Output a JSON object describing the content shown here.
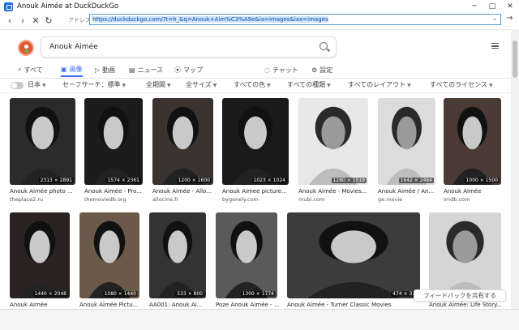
{
  "window": {
    "title": "Anouk Aimée at DuckDuckGo",
    "minimize": "─",
    "maximize": "□",
    "close": "✕"
  },
  "address_bar": {
    "label": "アドレス(D)",
    "url": "https://duckduckgo.com/?t=h_&q=Anouk+Aim%C3%A9e&ia=images&iax=images"
  },
  "nav": {
    "back": "‹",
    "forward": "›",
    "stop": "✕",
    "refresh": "↻",
    "go": "→"
  },
  "search": {
    "query": "Anouk Aimée"
  },
  "tabs": [
    {
      "label": "すべて",
      "icon": "magnifier-icon"
    },
    {
      "label": "画像",
      "icon": "image-icon",
      "active": true
    },
    {
      "label": "動画",
      "icon": "play-icon"
    },
    {
      "label": "ニュース",
      "icon": "newspaper-icon"
    },
    {
      "label": "マップ",
      "icon": "map-pin-icon"
    },
    {
      "label": "チャット",
      "icon": "chat-icon"
    },
    {
      "label": "設定",
      "icon": "gear-icon"
    }
  ],
  "filters": [
    {
      "label": "日本"
    },
    {
      "label": "セーフサーチ：標準"
    },
    {
      "label": "全期間"
    },
    {
      "label": "全サイズ"
    },
    {
      "label": "すべての色"
    },
    {
      "label": "すべての種類"
    },
    {
      "label": "すべてのレイアウト"
    },
    {
      "label": "すべてのライセンス"
    }
  ],
  "results_row1": [
    {
      "title": "Anouk Aimée photo ...",
      "source": "theplace2.ru",
      "dims": "2313 × 2891"
    },
    {
      "title": "Anouk Aimée - Pro...",
      "source": "themoviedb.org",
      "dims": "1574 × 2361"
    },
    {
      "title": "Anouk Aimée - Allo...",
      "source": "allocine.fr",
      "dims": "1200 × 1600"
    },
    {
      "title": "Anouk Aimee picture...",
      "source": "bygonely.com",
      "dims": "1023 × 1024"
    },
    {
      "title": "Anouk Aimée - Movies...",
      "source": "mubi.com",
      "dims": "1280 × 1519"
    },
    {
      "title": "Anouk Aimée / An...",
      "source": "ge.movie",
      "dims": "1642 × 2464"
    },
    {
      "title": "Anouk Aimée",
      "source": "imdb.com",
      "dims": "1000 × 1500"
    }
  ],
  "results_row2": [
    {
      "title": "Anouk Aimée",
      "source": "",
      "dims": "1440 × 2048"
    },
    {
      "title": "Anouk Aimée Pictu...",
      "source": "",
      "dims": "1080 × 1440"
    },
    {
      "title": "AA001: Anouk Ai...",
      "source": "",
      "dims": "533 × 800"
    },
    {
      "title": "Poze Anouk Aimée - ...",
      "source": "",
      "dims": "1300 × 1774"
    },
    {
      "title": "Anouk Aimée - Turner Classic Movies",
      "source": "",
      "dims": "474 × 3..."
    },
    {
      "title": "Anouk Aimée: Life Story...",
      "source": "",
      "dims": ""
    }
  ],
  "feedback": "フィードバックを共有する"
}
